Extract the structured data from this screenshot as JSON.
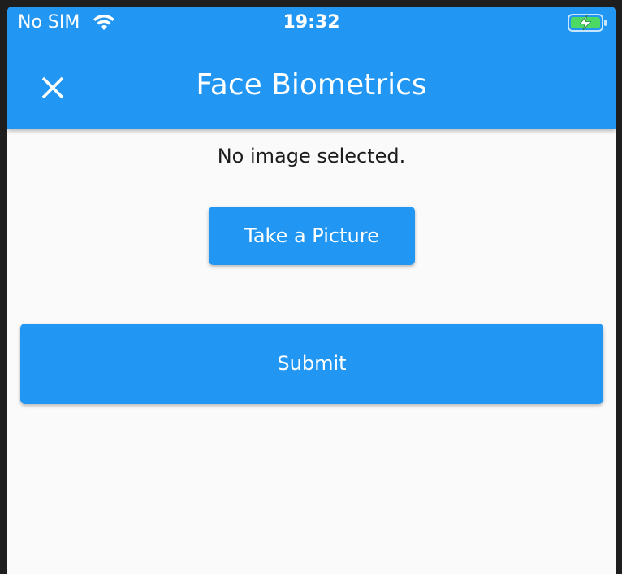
{
  "status_bar": {
    "carrier": "No SIM",
    "time": "19:32",
    "wifi_icon": "wifi-icon",
    "battery_icon": "battery-charging-icon",
    "battery_color": "#4cd964"
  },
  "app_bar": {
    "title": "Face Biometrics",
    "close_icon": "close-icon",
    "background_color": "#2196f3"
  },
  "main": {
    "status_text": "No image selected.",
    "take_picture_label": "Take a Picture",
    "submit_label": "Submit"
  }
}
